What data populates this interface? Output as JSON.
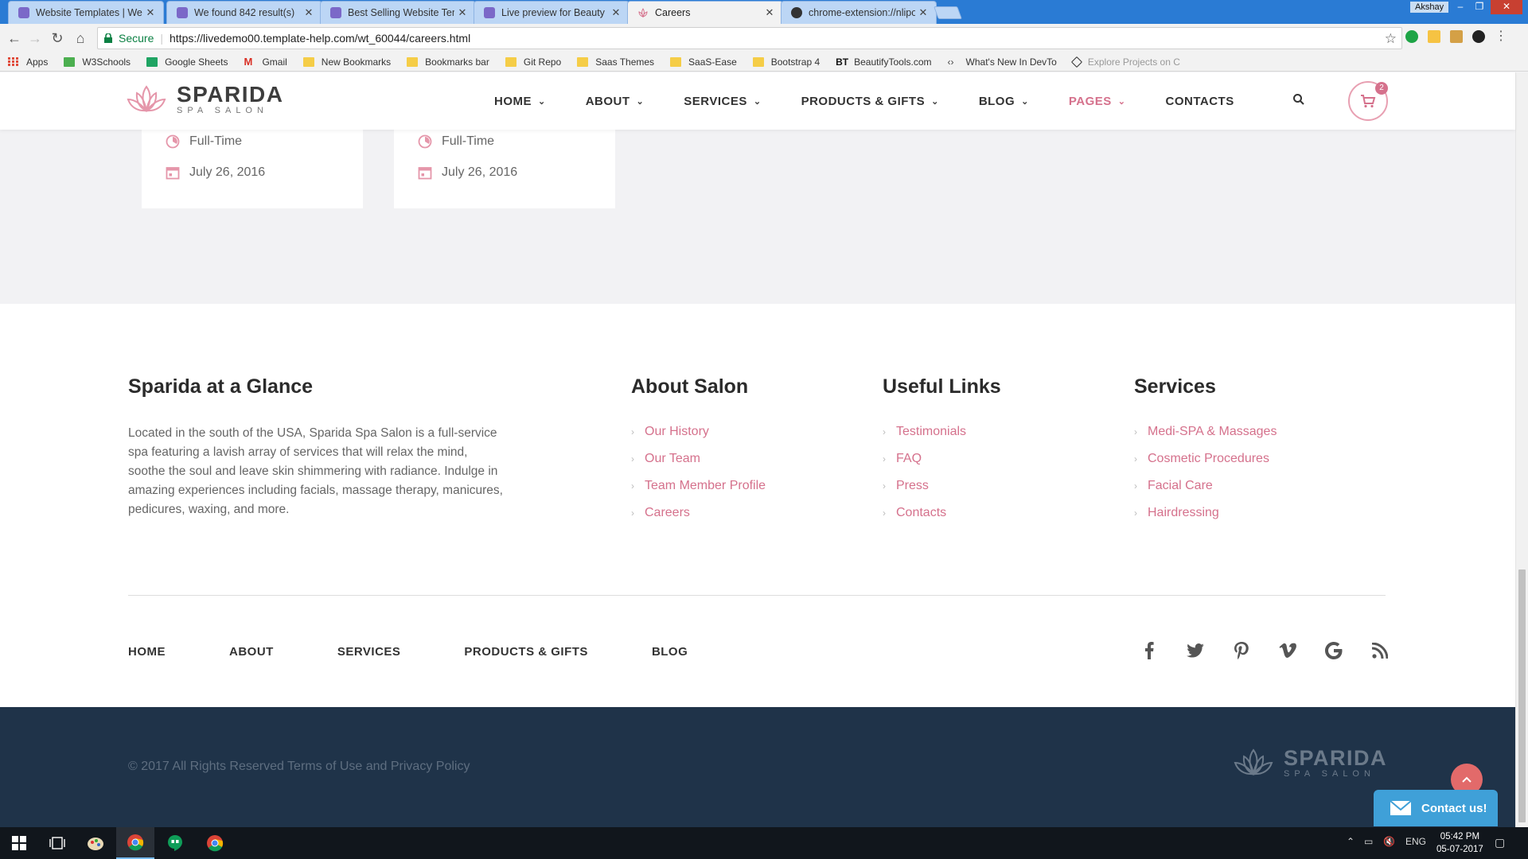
{
  "browser": {
    "tabs": [
      {
        "title": "Website Templates | Web",
        "active": false
      },
      {
        "title": "We found 842 result(s)",
        "active": false
      },
      {
        "title": "Best Selling Website Tem",
        "active": false
      },
      {
        "title": "Live preview for Beauty F",
        "active": false
      },
      {
        "title": "Careers",
        "active": true
      },
      {
        "title": "chrome-extension://nlipo",
        "active": false
      }
    ],
    "user": "Akshay",
    "secure_label": "Secure",
    "url": "https://livedemo00.template-help.com/wt_60044/careers.html",
    "bookmarks": [
      "Apps",
      "W3Schools",
      "Google Sheets",
      "Gmail",
      "New Bookmarks",
      "Bookmarks bar",
      "Git Repo",
      "Saas Themes",
      "SaaS-Ease",
      "Bootstrap 4",
      "BeautifyTools.com",
      "What's New In DevTo",
      "Explore Projects on C"
    ]
  },
  "site": {
    "logo": {
      "main": "SPARIDA",
      "sub": "SPA SALON"
    },
    "nav": [
      {
        "label": "HOME",
        "has_dropdown": true
      },
      {
        "label": "ABOUT",
        "has_dropdown": true
      },
      {
        "label": "SERVICES",
        "has_dropdown": true
      },
      {
        "label": "PRODUCTS & GIFTS",
        "has_dropdown": true
      },
      {
        "label": "BLOG",
        "has_dropdown": true
      },
      {
        "label": "PAGES",
        "has_dropdown": true,
        "active": true
      },
      {
        "label": "CONTACTS",
        "has_dropdown": false
      }
    ],
    "cart_count": "2",
    "accent_color": "#d5718c"
  },
  "jobs": [
    {
      "type": "Full-Time",
      "date": "July 26, 2016"
    },
    {
      "type": "Full-Time",
      "date": "July 26, 2016"
    }
  ],
  "footer": {
    "glance": {
      "title": "Sparida at a Glance",
      "text": "Located in the south of the USA, Sparida Spa Salon is a full-service spa featuring a lavish array of services that will relax the mind, soothe the soul and leave skin shimmering with radiance. Indulge in amazing experiences including facials, massage therapy, manicures, pedicures, waxing, and more."
    },
    "about": {
      "title": "About Salon",
      "links": [
        "Our History",
        "Our Team",
        "Team Member Profile",
        "Careers"
      ]
    },
    "useful": {
      "title": "Useful Links",
      "links": [
        "Testimonials",
        "FAQ",
        "Press",
        "Contacts"
      ]
    },
    "services": {
      "title": "Services",
      "links": [
        "Medi-SPA & Massages",
        "Cosmetic Procedures",
        "Facial Care",
        "Hairdressing"
      ]
    },
    "bottom_nav": [
      "HOME",
      "ABOUT",
      "SERVICES",
      "PRODUCTS & GIFTS",
      "BLOG"
    ],
    "socials": [
      "facebook-icon",
      "twitter-icon",
      "pinterest-icon",
      "vimeo-icon",
      "google-icon",
      "rss-icon"
    ],
    "copyright": "© 2017  All Rights Reserved Terms of Use and Privacy Policy",
    "contact_button": "Contact us!"
  },
  "taskbar": {
    "language": "ENG",
    "time": "05:42 PM",
    "date": "05-07-2017"
  }
}
